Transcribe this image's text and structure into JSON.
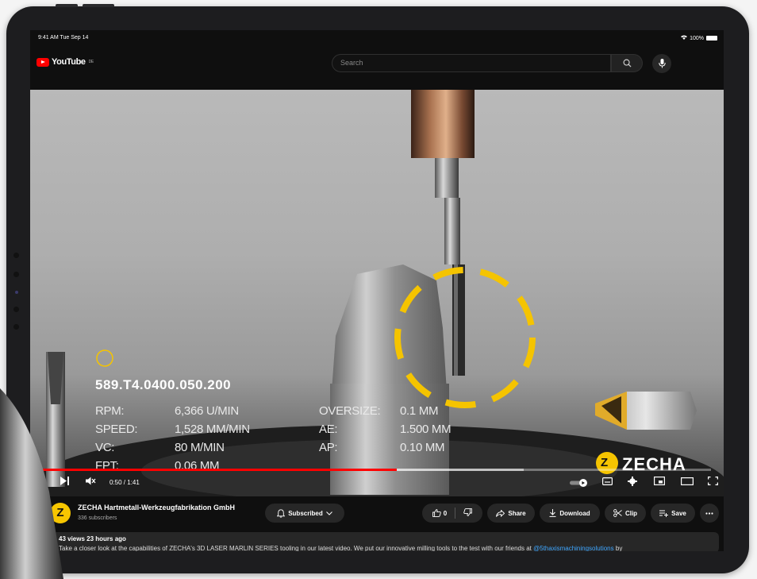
{
  "status": {
    "time": "9:41 AM  Tue Sep 14",
    "battery": "100%"
  },
  "header": {
    "logo_text": "YouTube",
    "region": "DE",
    "search_placeholder": "Search"
  },
  "video": {
    "product_code": "589.T4.0400.050.200",
    "specs_left": [
      {
        "label": "RPM:",
        "value": "6,366 U/MIN"
      },
      {
        "label": "SPEED:",
        "value": "1,528 MM/MIN"
      },
      {
        "label": "VC:",
        "value": "80 M/MIN"
      },
      {
        "label": "FPT:",
        "value": "0.06 MM"
      }
    ],
    "specs_right": [
      {
        "label": "OVERSIZE:",
        "value": "0.1 MM"
      },
      {
        "label": "AE:",
        "value": "1.500 MM"
      },
      {
        "label": "AP:",
        "value": "0.10 MM"
      }
    ],
    "brand": "ZECHA",
    "brand_mark": "Z",
    "accent_color": "#f5c400",
    "progress_fraction": 0.53,
    "buffer_fraction": 0.72,
    "time_display": "0:50 / 1:41"
  },
  "channel": {
    "avatar_letter": "Z",
    "name": "ZECHA Hartmetall-Werkzeugfabrikation GmbH",
    "subscribers": "336 subscribers",
    "subscribed_label": "Subscribed",
    "like_count": "0",
    "share_label": "Share",
    "download_label": "Download",
    "clip_label": "Clip",
    "save_label": "Save"
  },
  "description": {
    "meta": "43 views  23 hours ago",
    "text": "Take a closer look at the capabilities of ZECHA's 3D LASER MARLIN SERIES tooling in our latest video. We put our innovative milling tools to the test with our friends at",
    "link": "@5thaxismachiningsolutions",
    "tail": "by"
  }
}
